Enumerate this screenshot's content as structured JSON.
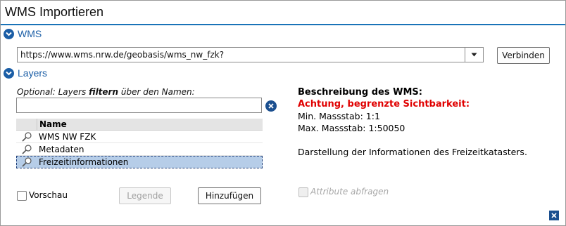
{
  "window": {
    "title": "WMS Importieren"
  },
  "wms_section": {
    "label": "WMS"
  },
  "url_field": {
    "value": "https://www.wms.nrw.de/geobasis/wms_nw_fzk?"
  },
  "connect_button": {
    "label": "Verbinden"
  },
  "layers_section": {
    "label": "Layers"
  },
  "filter": {
    "label_prefix": "Optional: Layers ",
    "label_bold": "filtern",
    "label_suffix": " über den Namen:",
    "value": ""
  },
  "layer_table": {
    "column_name": "Name",
    "rows": [
      {
        "name": "WMS NW FZK",
        "selected": false
      },
      {
        "name": "Metadaten",
        "selected": false
      },
      {
        "name": "Freizeitinformationen",
        "selected": true
      }
    ]
  },
  "preview": {
    "label": "Vorschau",
    "checked": false
  },
  "legend_button": {
    "label": "Legende",
    "enabled": false
  },
  "add_button": {
    "label": "Hinzufügen"
  },
  "attributes": {
    "label": "Attribute abfragen",
    "enabled": false
  },
  "description": {
    "heading": "Beschreibung des WMS:",
    "warning": "Achtung, begrenzte Sichtbarkeit:",
    "min_scale": "Min. Massstab: 1:1",
    "max_scale": "Max. Massstab: 1:50050",
    "text": "Darstellung der Informationen des Freizeitkatasters."
  },
  "colors": {
    "accent": "#1b5ea6",
    "warning": "#e00000",
    "selection": "#b6cde8"
  },
  "icons": {
    "section_toggle": "chevron-down-circle-icon",
    "dropdown": "triangle-down-icon",
    "clear": "close-circle-icon",
    "layer_row": "magnifier-icon",
    "dialog_close": "close-icon"
  }
}
